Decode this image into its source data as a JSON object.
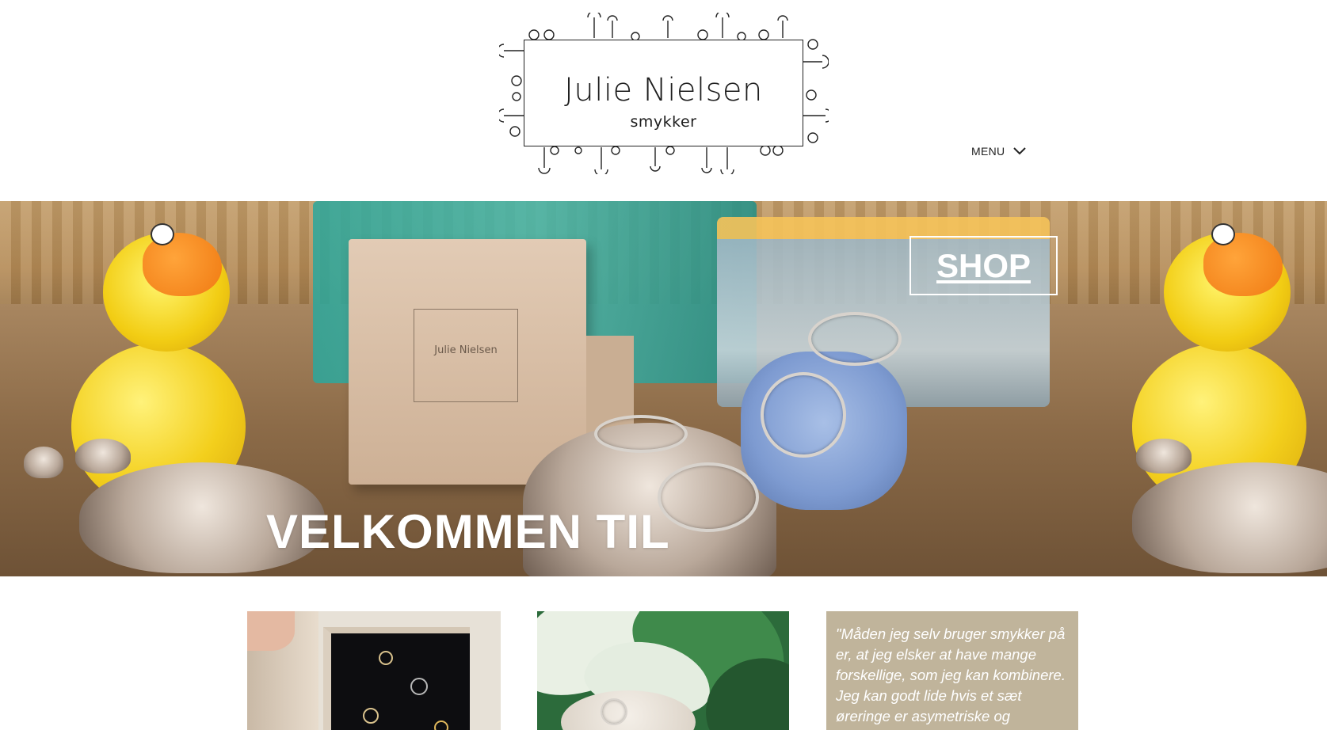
{
  "header": {
    "logo": {
      "name": "Julie Nielsen",
      "subtitle": "smykker"
    },
    "menu_label": "MENU"
  },
  "hero": {
    "title": "VELKOMMEN TIL",
    "shop_label": "SHOP",
    "box_label": "Julie Nielsen"
  },
  "quote": {
    "text": "\"Måden jeg selv bruger smykker på er, at jeg elsker at have mange forskellige, som jeg kan kombinere. Jeg kan godt lide hvis et sæt øreringe er asymetriske og"
  },
  "colors": {
    "quote_bg": "#c0b49b",
    "accent_white": "#ffffff"
  },
  "icons": {
    "menu": "chevron-down-icon"
  }
}
